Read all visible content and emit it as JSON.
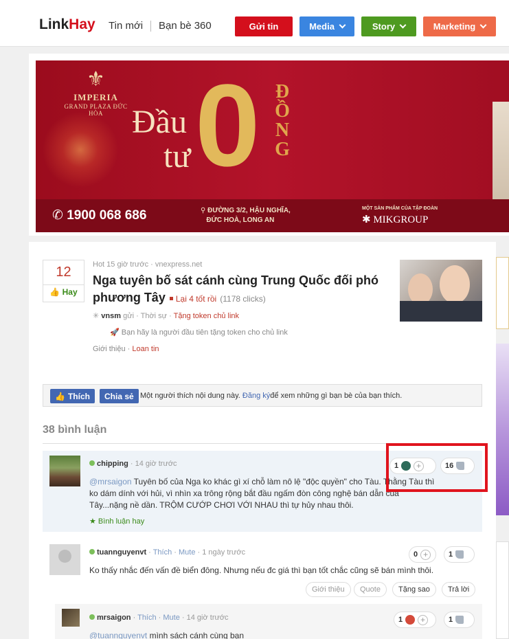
{
  "header": {
    "logo_link": "Link",
    "logo_hay": "Hay",
    "nav_new": "Tin mới",
    "nav_friends": "Bạn bè 360",
    "btn_submit": "Gửi tin",
    "btn_media": "Media",
    "btn_story": "Story",
    "btn_marketing": "Marketing",
    "colors": {
      "submit": "#d40f1c",
      "media": "#3a85e0",
      "story": "#4e9a20",
      "marketing": "#ee6a48"
    }
  },
  "ad": {
    "brand_name": "IMPERIA",
    "brand_sub": "GRAND PLAZA ĐỨC HÒA",
    "dautu_1": "Đầu",
    "dautu_2": "tư",
    "zero": "0",
    "dong": "ĐỒNG",
    "phone": "1900 068 686",
    "address_1": "ĐƯỜNG 3/2, HẬU NGHĨA,",
    "address_2": "ĐỨC HOÀ, LONG AN",
    "group_label": "MỘT SẢN PHẨM CỦA TẬP ĐOÀN",
    "group_name": "MIKGROUP"
  },
  "article": {
    "score": "12",
    "hay_label": "Hay",
    "hot": "Hot 15 giờ trước",
    "source": "vnexpress.net",
    "title": "Nga tuyên bố sát cánh cùng Trung Quốc đối phó phương Tây",
    "again": "Lại 4 tốt rồi",
    "clicks": "(1178 clicks)",
    "poster": "vnsm",
    "sent": "gửi",
    "category": "Thời sự",
    "token_link": "Tặng token chủ link",
    "donate_prompt": "Bạn hãy là người đầu tiên tặng token cho chủ link",
    "intro": "Giới thiệu",
    "spread": "Loan tin"
  },
  "facebook": {
    "like": "Thích",
    "share": "Chia sẻ",
    "text_before": "Một người thích nội dung này.",
    "signup": "Đăng ký",
    "text_after": "để xem những gì bạn bè của bạn thích."
  },
  "comments_count": "38 bình luận",
  "comments": [
    {
      "user": "chipping",
      "time": "14 giờ trước",
      "mention": "@mrsaigon",
      "text": " Tuyên bố của Nga ko khác gì xí chỗ làm nô lệ \"độc quyền\" cho Tàu. Thằng Tàu thì ko dám dính với hủi, vì nhìn xa trông rộng bắt đầu ngấm đòn công nghệ bán dẫn của Tây...nặng nề dần. TRỘM CƯỚP CHƠI VỚI NHAU thì tự hủy nhau thôi.",
      "good": "Bình luận hay",
      "reactions": "1",
      "likes": "16"
    },
    {
      "user": "tuannguyenvt",
      "like": "Thích",
      "mute": "Mute",
      "time": "1 ngày trước",
      "text": "Ko thấy nhắc đến vấn đề biển đông. Nhưng nếu đc giá thì bạn tốt chắc cũng sẽ bán mình thôi.",
      "reactions": "0",
      "likes": "1",
      "btn_intro": "Giới thiệu",
      "btn_quote": "Quote",
      "btn_gift": "Tặng sao",
      "btn_reply": "Trả lời"
    },
    {
      "user": "mrsaigon",
      "like": "Thích",
      "mute": "Mute",
      "time": "14 giờ trước",
      "mention": "@tuannguyenvt",
      "text": " mình sách cánh cùng bạn",
      "reactions": "1",
      "likes": "1"
    }
  ]
}
